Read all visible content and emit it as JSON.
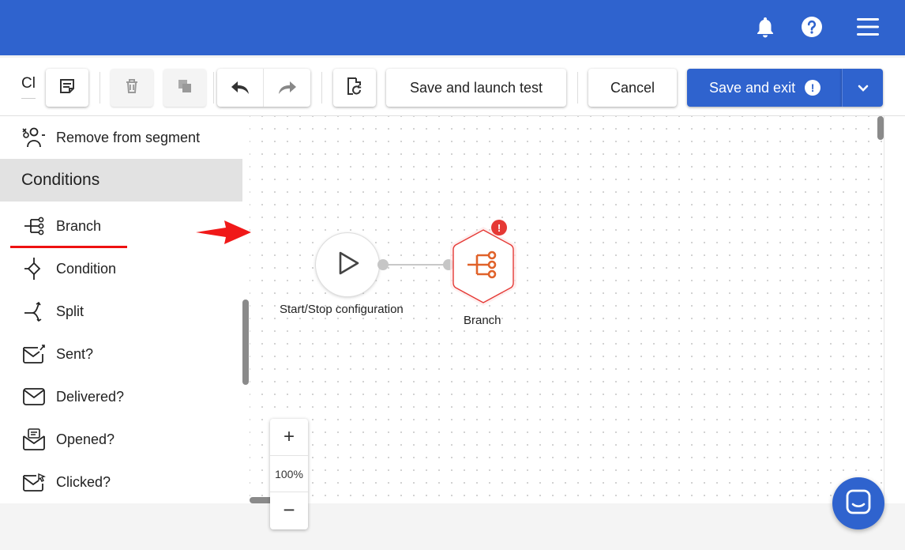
{
  "topbar": {
    "bell_icon": "bell-icon",
    "help_icon": "help-icon",
    "menu_icon": "hamburger-icon",
    "color": "#2f63ce"
  },
  "toolbar": {
    "name_stub": "Cl",
    "notes_icon": "notes-icon",
    "delete_icon": "trash-icon",
    "copy_icon": "copy-icon",
    "undo_icon": "undo-icon",
    "redo_icon": "redo-icon",
    "history_icon": "history-icon",
    "launch_test_label": "Save and launch test",
    "cancel_label": "Cancel",
    "save_exit_label": "Save and exit",
    "save_exit_badge": "!"
  },
  "sidebar": {
    "items_before": [
      {
        "label": "Remove from segment",
        "icon": "remove-segment-icon"
      }
    ],
    "section_title": "Conditions",
    "items": [
      {
        "label": "Branch",
        "icon": "branch-icon"
      },
      {
        "label": "Condition",
        "icon": "condition-icon"
      },
      {
        "label": "Split",
        "icon": "split-icon"
      },
      {
        "label": "Sent?",
        "icon": "sent-icon"
      },
      {
        "label": "Delivered?",
        "icon": "delivered-icon"
      },
      {
        "label": "Opened?",
        "icon": "opened-icon"
      },
      {
        "label": "Clicked?",
        "icon": "clicked-icon"
      }
    ]
  },
  "canvas": {
    "start_node_label": "Start/Stop configuration",
    "branch_node_label": "Branch",
    "branch_warning": "!",
    "zoom_in": "+",
    "zoom_level": "100%",
    "zoom_out": "−"
  },
  "accent": "#e53935",
  "chat_icon": "chat-icon"
}
